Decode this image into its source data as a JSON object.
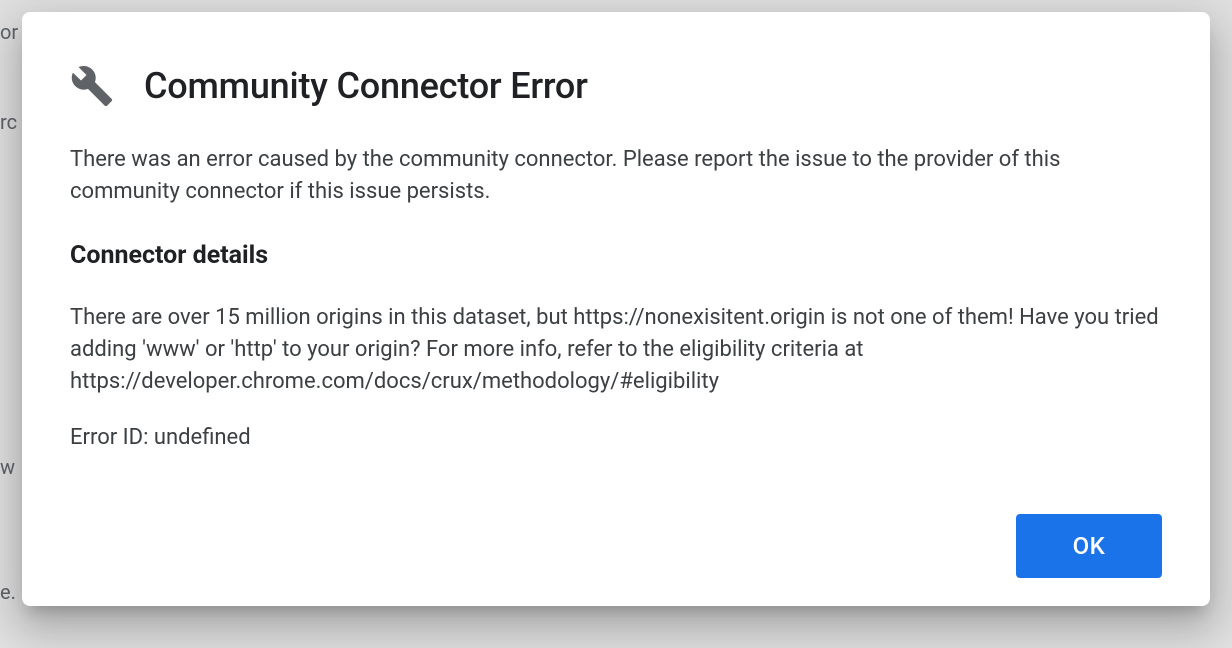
{
  "dialog": {
    "title": "Community Connector Error",
    "intro": "There was an error caused by the community connector. Please report the issue to the provider of this community connector if this issue persists.",
    "details_heading": "Connector details",
    "details_text": "There are over 15 million origins in this dataset, but https://nonexisitent.origin is not one of them! Have you tried adding 'www' or 'http' to your origin? For more info, refer to the eligibility criteria at https://developer.chrome.com/docs/crux/methodology/#eligibility",
    "error_id_label": "Error ID: undefined",
    "ok_label": "OK"
  },
  "background": {
    "line1": "or",
    "line2": "rc",
    "line3": "w",
    "line4": "e."
  }
}
